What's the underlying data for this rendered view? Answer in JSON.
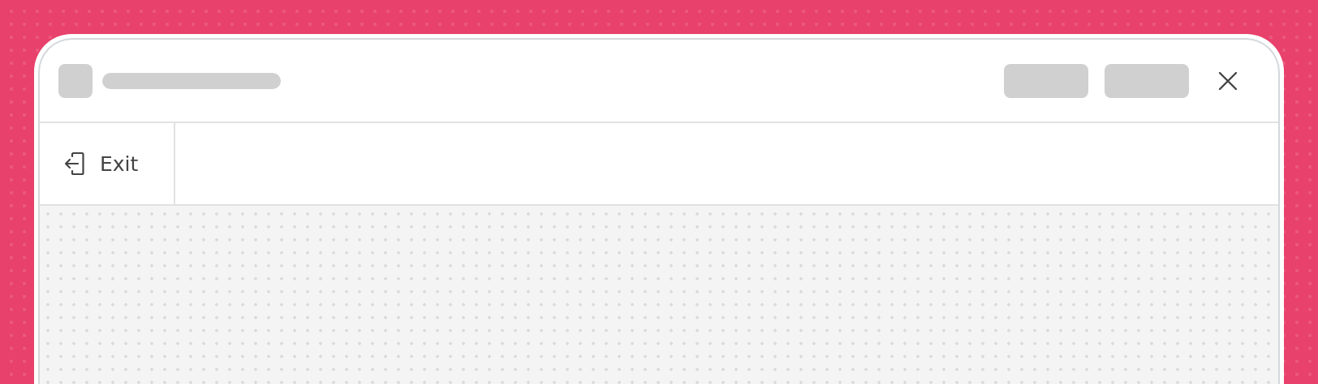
{
  "toolbar": {
    "exit_button": {
      "label": "Exit"
    }
  }
}
